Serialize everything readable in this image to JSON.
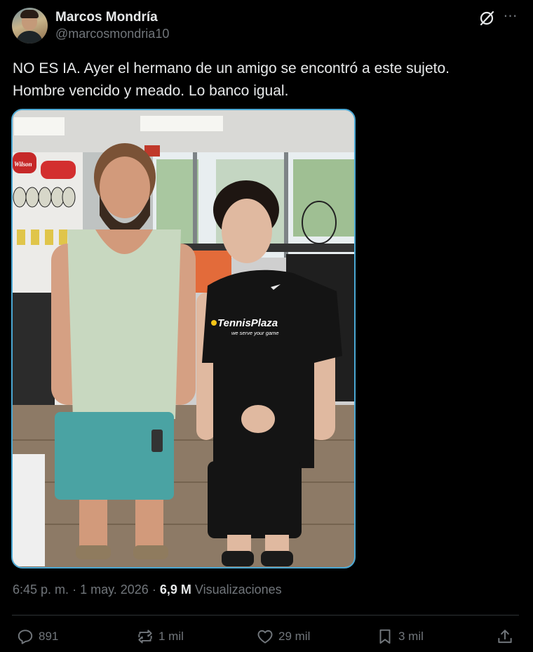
{
  "author": {
    "name": "Marcos Mondría",
    "handle": "@marcosmondria10"
  },
  "tweet": {
    "line1": "NO ES IA. Ayer el hermano de un amigo se encontró a este sujeto.",
    "line2": "Hombre vencido y meado. Lo banco igual."
  },
  "photo": {
    "shirt_brand": "TennisPlaza",
    "shirt_tagline": "we serve your game",
    "store_sign": "Wilson"
  },
  "meta": {
    "time": "6:45 p. m.",
    "separator": "·",
    "date": "1 may. 2026",
    "views_count": "6,9 M",
    "views_label": "Visualizaciones"
  },
  "actions": {
    "replies": "891",
    "reposts": "1 mil",
    "likes": "29 mil",
    "bookmarks": "3 mil"
  },
  "icons": {
    "grok": "grok-icon",
    "more": "more-icon",
    "reply": "reply-icon",
    "repost": "repost-icon",
    "like": "heart-icon",
    "bookmark": "bookmark-icon",
    "share": "share-icon"
  },
  "colors": {
    "background": "#000000",
    "text": "#e7e9ea",
    "secondary": "#71767b",
    "photo_border": "#4ba8d4"
  }
}
